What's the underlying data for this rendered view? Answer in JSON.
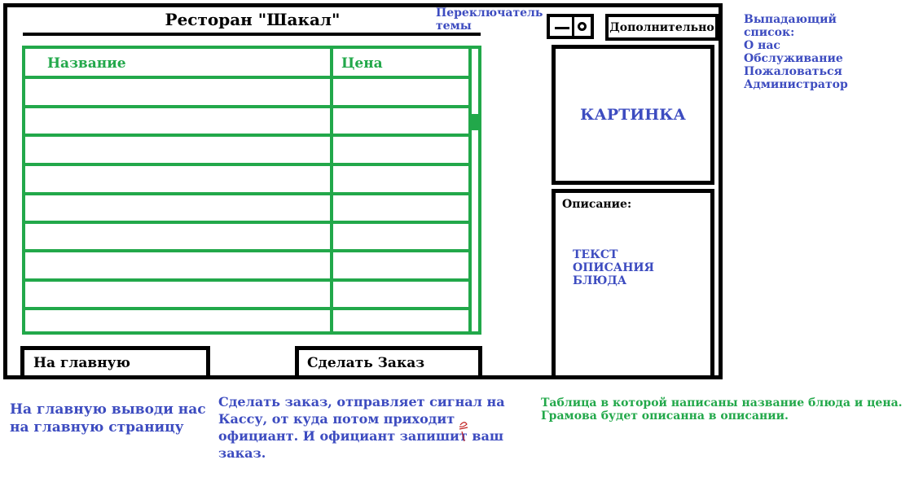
{
  "header": {
    "title": "Ресторан \"Шакал\"",
    "theme_note": "Переключатель темы",
    "more_label": "Дополнительно"
  },
  "dropdown_note": [
    "Выпадающий",
    "список:",
    "О нас",
    "Обслуживание",
    "Пожаловаться",
    "Администратор"
  ],
  "menu_table": {
    "columns": [
      "Название",
      "Цена"
    ],
    "empty_rows": 9
  },
  "picture": {
    "label": "КАРТИНКА"
  },
  "description": {
    "label": "Описание:",
    "text": "ТЕКСТ ОПИСАНИЯ БЛЮДА"
  },
  "buttons": {
    "home": "На главную",
    "order": "Сделать Заказ"
  },
  "notes": {
    "home": "На главную выводи нас на главную страницу",
    "order": "Сделать заказ, отправляет сигнал на Кассу, от куда потом приходит официант. И официант запишит ваш заказ.",
    "table": "Таблица в которой написаны название блюда и цена. Грамова будет описанна в описании."
  },
  "colors": {
    "accent_blue": "#3d4cc0",
    "table_green": "#22a84a",
    "border": "#000000"
  }
}
